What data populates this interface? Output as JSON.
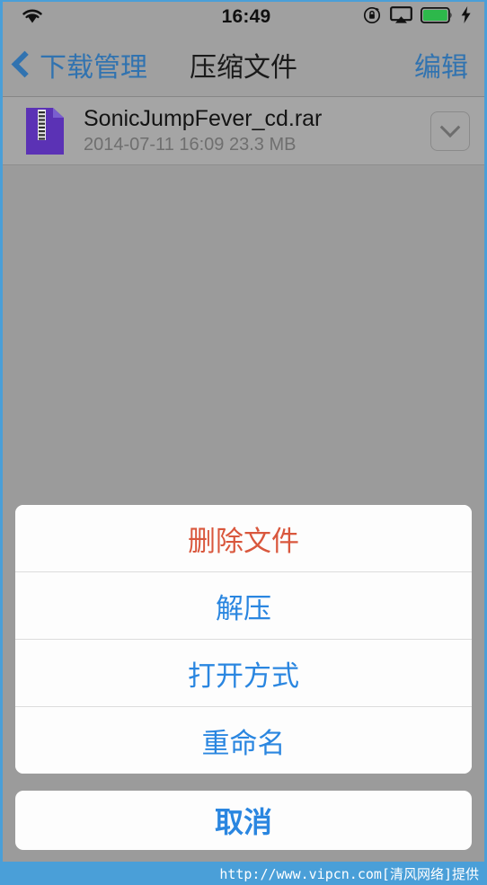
{
  "status_bar": {
    "time": "16:49",
    "wifi_icon": "wifi-icon",
    "rotation_lock_icon": "rotation-lock-icon",
    "airplay_icon": "airplay-icon",
    "battery_icon": "battery-full-icon",
    "charging_icon": "lightning-bolt-icon",
    "battery_color": "#2db84b"
  },
  "nav_bar": {
    "back_label": "下载管理",
    "back_icon": "chevron-left-icon",
    "title": "压缩文件",
    "edit_label": "编辑",
    "tint_color": "#3173b0"
  },
  "file_list": {
    "rows": [
      {
        "icon": "rar-archive-icon",
        "icon_color": "#5b32b5",
        "name": "SonicJumpFever_cd.rar",
        "meta": "2014-07-11 16:09 23.3 MB",
        "disclosure_icon": "chevron-down-icon"
      }
    ]
  },
  "action_sheet": {
    "items": [
      {
        "label": "删除文件",
        "style": "destructive",
        "color": "#d9573d"
      },
      {
        "label": "解压",
        "style": "normal",
        "color": "#2a86e0"
      },
      {
        "label": "打开方式",
        "style": "normal",
        "color": "#2a86e0"
      },
      {
        "label": "重命名",
        "style": "normal",
        "color": "#2a86e0"
      }
    ],
    "cancel_label": "取消"
  },
  "footer": {
    "watermark": "http://www.vipcn.com[清风网络]提供",
    "background_color": "#4a9fd8"
  }
}
